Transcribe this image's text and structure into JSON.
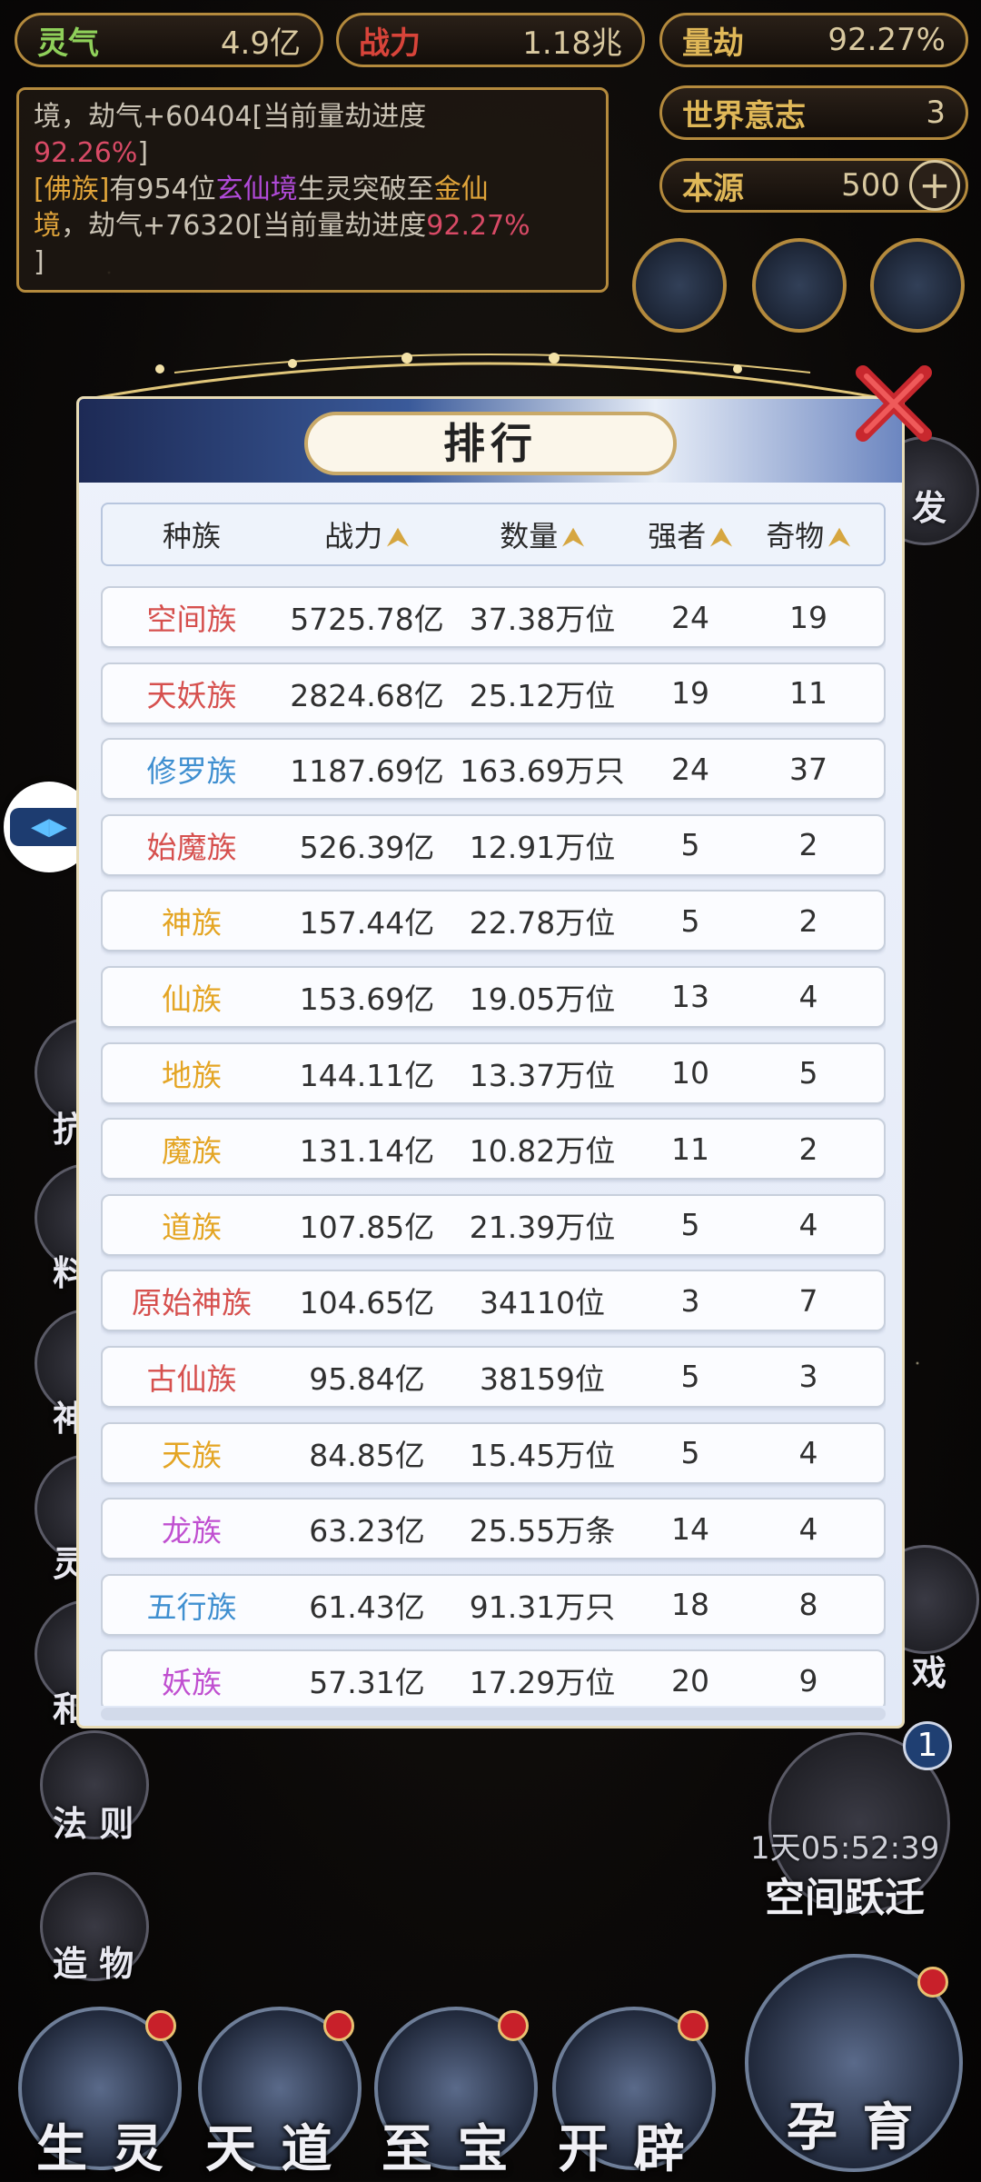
{
  "stats": {
    "lingqi": {
      "label": "灵气",
      "value": "4.9亿"
    },
    "zhanli": {
      "label": "战力",
      "value": "1.18兆"
    },
    "liangjie": {
      "label": "量劫",
      "value": "92.27%"
    },
    "world_will": {
      "label": "世界意志",
      "value": "3"
    },
    "source": {
      "label": "本源",
      "value": "500",
      "add": "+"
    }
  },
  "log": {
    "line1": "境，劫气+60404[当前量劫进度",
    "line1_pct": "92.26%",
    "line1_end": "]",
    "line2_tag": "[佛族]",
    "line2_a": "有954位",
    "line2_realm": "玄仙境",
    "line2_b": "生灵突破至",
    "line2_target": "金仙",
    "line3_target": "境",
    "line3_a": "，劫气+76320[当前量劫进度",
    "line3_pct": "92.27%",
    "line4": "]"
  },
  "side": {
    "right_partial": "发",
    "right_partial2": "戏",
    "badge_count": "1",
    "timer": "1天05:52:39",
    "space_jump": "空间跃迁",
    "fa_ze": "法 则",
    "zao_wu": "造 物",
    "left_partials": [
      "抗",
      "料",
      "神",
      "灵",
      "和"
    ]
  },
  "bottom": {
    "shengling": "生 灵",
    "tiandao": "天 道",
    "zhibao": "至 宝",
    "kaipi": "开 辟",
    "yunyu": "孕 育"
  },
  "float_btn": "◀▶",
  "modal": {
    "title": "排行",
    "headers": {
      "race": "种族",
      "power": "战力",
      "count": "数量",
      "strong": "强者",
      "treasure": "奇物"
    },
    "sort_arrow": "⮝",
    "rows": [
      {
        "race": "空间族",
        "power": "5725.78亿",
        "count": "37.38万位",
        "strong": "24",
        "treasure": "19",
        "color": "#d6504e"
      },
      {
        "race": "天妖族",
        "power": "2824.68亿",
        "count": "25.12万位",
        "strong": "19",
        "treasure": "11",
        "color": "#d6504e"
      },
      {
        "race": "修罗族",
        "power": "1187.69亿",
        "count": "163.69万只",
        "strong": "24",
        "treasure": "37",
        "color": "#3f8fd0"
      },
      {
        "race": "始魔族",
        "power": "526.39亿",
        "count": "12.91万位",
        "strong": "5",
        "treasure": "2",
        "color": "#d6504e"
      },
      {
        "race": "神族",
        "power": "157.44亿",
        "count": "22.78万位",
        "strong": "5",
        "treasure": "2",
        "color": "#e4a524"
      },
      {
        "race": "仙族",
        "power": "153.69亿",
        "count": "19.05万位",
        "strong": "13",
        "treasure": "4",
        "color": "#e4a524"
      },
      {
        "race": "地族",
        "power": "144.11亿",
        "count": "13.37万位",
        "strong": "10",
        "treasure": "5",
        "color": "#e4a524"
      },
      {
        "race": "魔族",
        "power": "131.14亿",
        "count": "10.82万位",
        "strong": "11",
        "treasure": "2",
        "color": "#e4a524"
      },
      {
        "race": "道族",
        "power": "107.85亿",
        "count": "21.39万位",
        "strong": "5",
        "treasure": "4",
        "color": "#e4a524"
      },
      {
        "race": "原始神族",
        "power": "104.65亿",
        "count": "34110位",
        "strong": "3",
        "treasure": "7",
        "color": "#d6504e"
      },
      {
        "race": "古仙族",
        "power": "95.84亿",
        "count": "38159位",
        "strong": "5",
        "treasure": "3",
        "color": "#d6504e"
      },
      {
        "race": "天族",
        "power": "84.85亿",
        "count": "15.45万位",
        "strong": "5",
        "treasure": "4",
        "color": "#e4a524"
      },
      {
        "race": "龙族",
        "power": "63.23亿",
        "count": "25.55万条",
        "strong": "14",
        "treasure": "4",
        "color": "#c04fd0"
      },
      {
        "race": "五行族",
        "power": "61.43亿",
        "count": "91.31万只",
        "strong": "18",
        "treasure": "8",
        "color": "#3f8fd0"
      },
      {
        "race": "妖族",
        "power": "57.31亿",
        "count": "17.29万位",
        "strong": "20",
        "treasure": "9",
        "color": "#c04fd0"
      }
    ]
  }
}
